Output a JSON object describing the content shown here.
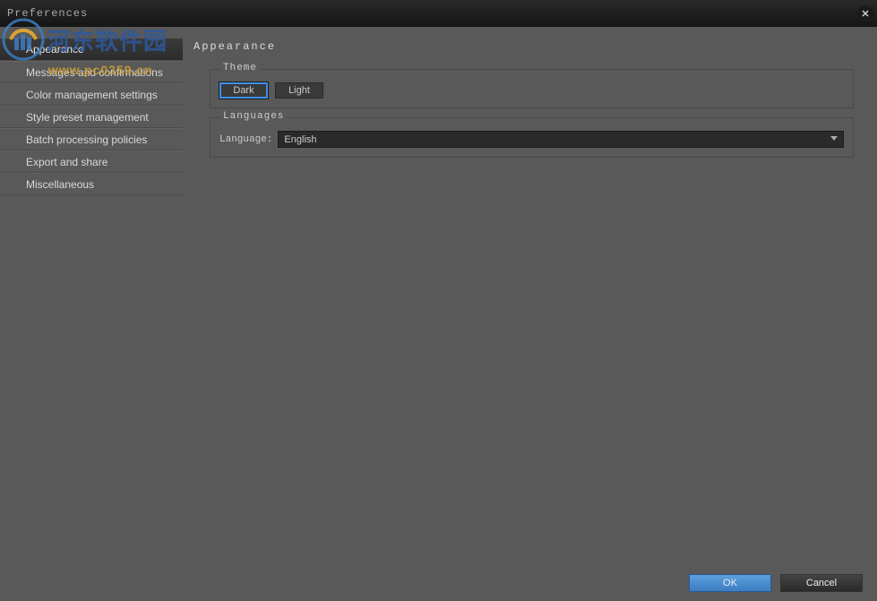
{
  "window": {
    "title": "Preferences"
  },
  "sidebar": {
    "items": [
      {
        "label": "Appearance",
        "active": true
      },
      {
        "label": "Messages and confirmations",
        "active": false
      },
      {
        "label": "Color management settings",
        "active": false
      },
      {
        "label": "Style preset management",
        "active": false
      },
      {
        "label": "Batch processing policies",
        "active": false
      },
      {
        "label": "Export and share",
        "active": false
      },
      {
        "label": "Miscellaneous",
        "active": false
      }
    ]
  },
  "content": {
    "title": "Appearance",
    "theme": {
      "legend": "Theme",
      "options": {
        "dark": "Dark",
        "light": "Light"
      },
      "selected": "dark"
    },
    "languages": {
      "legend": "Languages",
      "label": "Language:",
      "selected": "English"
    }
  },
  "footer": {
    "ok": "OK",
    "cancel": "Cancel"
  },
  "watermark": {
    "text_cn": "河东软件园",
    "url": "www.pc0359.cn"
  }
}
